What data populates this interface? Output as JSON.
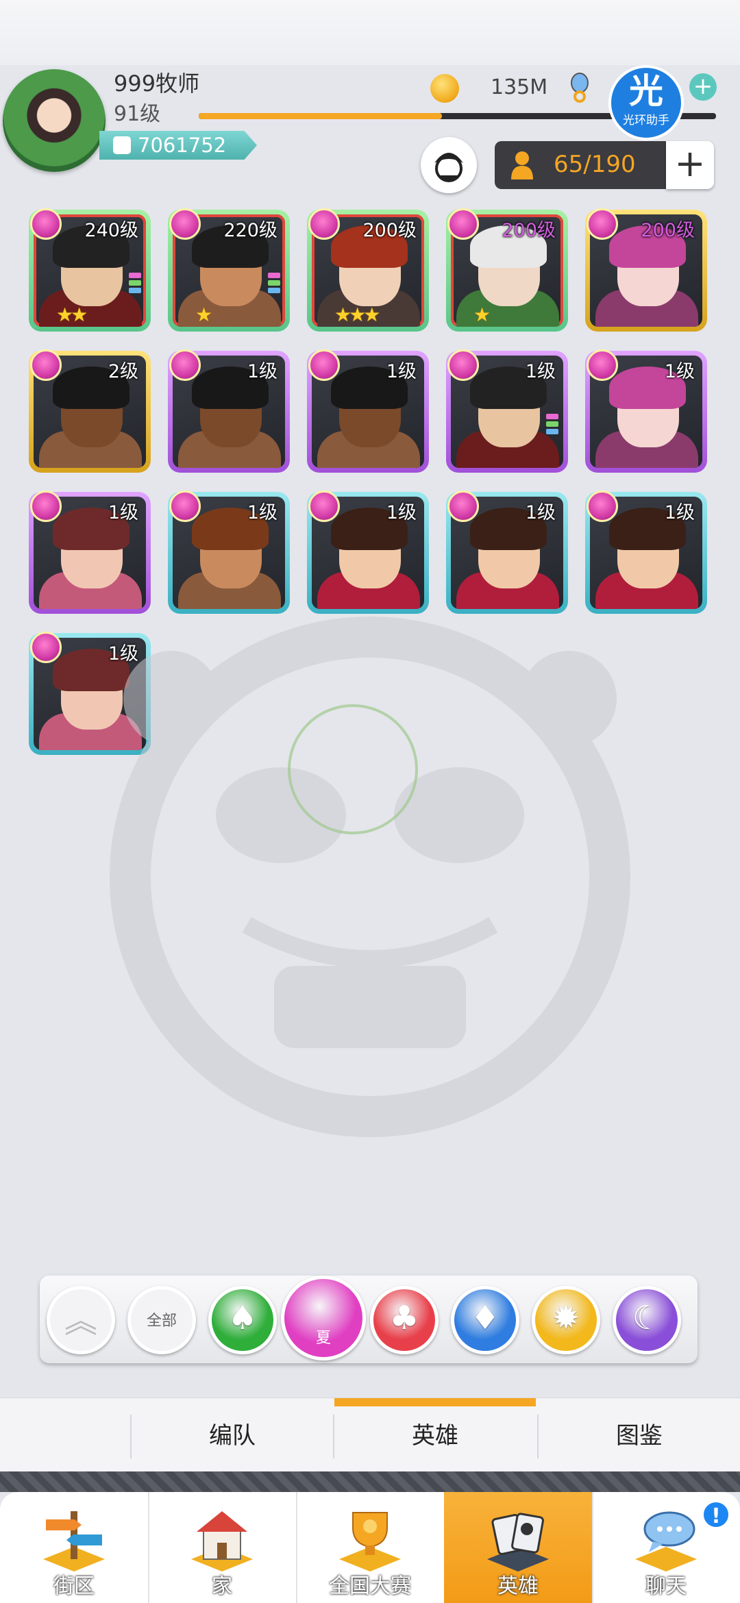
{
  "player": {
    "name": "999牧师",
    "level": "91级",
    "power": "7061752",
    "exp_fraction": 0.47,
    "coins": "135M"
  },
  "helper": {
    "big": "光",
    "small": "光环助手"
  },
  "capacity": {
    "text": "65/190",
    "add": "+"
  },
  "heroes": [
    {
      "level": "240级",
      "border": "green",
      "stars": "★★",
      "skin": "#e8c4a0",
      "hair": "#222",
      "body": "#6b1d1d"
    },
    {
      "level": "220级",
      "border": "green",
      "stars": "★",
      "skin": "#c98b5e",
      "hair": "#1d1d1d",
      "body": "#8a5a3c"
    },
    {
      "level": "200级",
      "border": "green",
      "stars": "★★★",
      "skin": "#f1d0b8",
      "hair": "#a4321c",
      "body": "#4a3a36"
    },
    {
      "level": "200级",
      "border": "green",
      "stars": "★",
      "skin": "#f0d8c6",
      "hair": "#e8e8e8",
      "body": "#3f7a3a",
      "level_color": "#d45de0"
    },
    {
      "level": "200级",
      "border": "gold",
      "stars": "",
      "skin": "#f6d6d2",
      "hair": "#c3469a",
      "body": "#8a3b6c",
      "level_color": "#d45de0"
    },
    {
      "level": "2级",
      "border": "gold",
      "stars": "",
      "skin": "#7a4a2a",
      "hair": "#181818",
      "body": "#8a5a3c"
    },
    {
      "level": "1级",
      "border": "purple",
      "stars": "",
      "skin": "#7a4a2a",
      "hair": "#181818",
      "body": "#8a5a3c"
    },
    {
      "level": "1级",
      "border": "purple",
      "stars": "",
      "skin": "#7a4a2a",
      "hair": "#181818",
      "body": "#8a5a3c"
    },
    {
      "level": "1级",
      "border": "purple",
      "stars": "",
      "skin": "#e8c4a0",
      "hair": "#222",
      "body": "#6b1d1d"
    },
    {
      "level": "1级",
      "border": "purple",
      "stars": "",
      "skin": "#f6d6d2",
      "hair": "#c3469a",
      "body": "#8a3b6c"
    },
    {
      "level": "1级",
      "border": "purple",
      "stars": "",
      "skin": "#f1c7b4",
      "hair": "#6e2a2a",
      "body": "#c45a7a"
    },
    {
      "level": "1级",
      "border": "cyan",
      "stars": "",
      "skin": "#c98b5e",
      "hair": "#7a3a1a",
      "body": "#8a5a3c"
    },
    {
      "level": "1级",
      "border": "cyan",
      "stars": "",
      "skin": "#f1c9a8",
      "hair": "#3a2016",
      "body": "#b01e3c"
    },
    {
      "level": "1级",
      "border": "cyan",
      "stars": "",
      "skin": "#f1c9a8",
      "hair": "#3a2016",
      "body": "#b01e3c"
    },
    {
      "level": "1级",
      "border": "cyan",
      "stars": "",
      "skin": "#f1c9a8",
      "hair": "#3a2016",
      "body": "#b01e3c"
    },
    {
      "level": "1级",
      "border": "cyan",
      "stars": "",
      "skin": "#f1c7b4",
      "hair": "#6e2a2a",
      "body": "#c45a7a"
    }
  ],
  "elements": [
    {
      "name": "collapse",
      "label": "",
      "glyph": "︽",
      "color": "#f3f3f5",
      "glyph_color": "#bbb"
    },
    {
      "name": "all",
      "label": "全部",
      "glyph": "",
      "color": "#f3f3f5",
      "glyph_color": "#999"
    },
    {
      "name": "nature",
      "label": "",
      "glyph": "♠",
      "color": "#2fae3a"
    },
    {
      "name": "summer",
      "label": "夏",
      "glyph": "",
      "color": "#e03fc2",
      "active": true
    },
    {
      "name": "fire",
      "label": "",
      "glyph": "♣",
      "color": "#e8404a"
    },
    {
      "name": "water",
      "label": "",
      "glyph": "♦",
      "color": "#2f7de0"
    },
    {
      "name": "light",
      "label": "",
      "glyph": "✹",
      "color": "#f2b81c"
    },
    {
      "name": "dark",
      "label": "",
      "glyph": "☾",
      "color": "#8a4fd8"
    }
  ],
  "tabs": [
    {
      "label": "编队"
    },
    {
      "label": "英雄",
      "active": true
    },
    {
      "label": "图鉴"
    }
  ],
  "nav": [
    {
      "label": "街区"
    },
    {
      "label": "家"
    },
    {
      "label": "全国大赛"
    },
    {
      "label": "英雄",
      "active": true
    },
    {
      "label": "聊天"
    }
  ],
  "notify": "!"
}
